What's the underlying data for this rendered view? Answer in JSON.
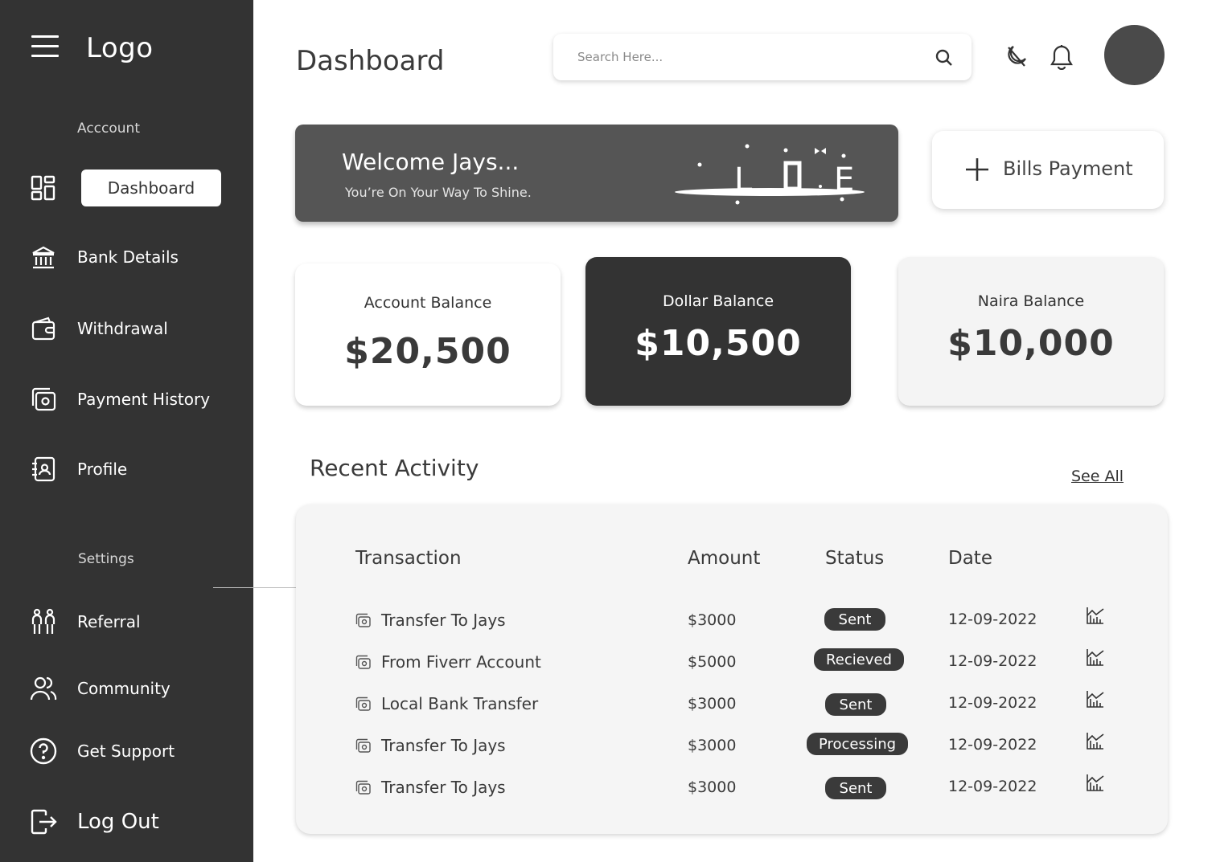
{
  "sidebar": {
    "logo": "Logo",
    "account_section": "Acccount",
    "settings_section": "Settings",
    "items": [
      {
        "label": "Dashboard",
        "icon": "dashboard-grid-icon"
      },
      {
        "label": "Bank Details",
        "icon": "bank-icon"
      },
      {
        "label": "Withdrawal",
        "icon": "wallet-icon"
      },
      {
        "label": "Payment History",
        "icon": "cash-history-icon"
      },
      {
        "label": "Profile",
        "icon": "contact-book-icon"
      },
      {
        "label": "Referral",
        "icon": "people-icon"
      },
      {
        "label": "Community",
        "icon": "community-icon"
      },
      {
        "label": "Get Support",
        "icon": "help-icon"
      },
      {
        "label": "Log Out",
        "icon": "logout-icon"
      }
    ]
  },
  "header": {
    "title": "Dashboard",
    "search_placeholder": "Search Here..."
  },
  "welcome": {
    "title": "Welcome Jays...",
    "subtitle": "You’re On Your Way To Shine."
  },
  "bills": {
    "label": "Bills Payment"
  },
  "balances": [
    {
      "label": "Account Balance",
      "value": "$20,500"
    },
    {
      "label": "Dollar Balance",
      "value": "$10,500"
    },
    {
      "label": "Naira Balance",
      "value": "$10,000"
    }
  ],
  "activity": {
    "title": "Recent Activity",
    "see_all": "See All",
    "columns": [
      "Transaction",
      "Amount",
      "Status",
      "Date"
    ],
    "rows": [
      {
        "name": "Transfer To Jays",
        "amount": "$3000",
        "status": "Sent",
        "date": "12-09-2022"
      },
      {
        "name": "From Fiverr Account",
        "amount": "$5000",
        "status": "Recieved",
        "date": "12-09-2022"
      },
      {
        "name": "Local Bank Transfer",
        "amount": "$3000",
        "status": "Sent",
        "date": "12-09-2022"
      },
      {
        "name": "Transfer To Jays",
        "amount": "$3000",
        "status": "Processing",
        "date": "12-09-2022"
      },
      {
        "name": "Transfer To Jays",
        "amount": "$3000",
        "status": "Sent",
        "date": "12-09-2022"
      }
    ]
  },
  "colors": {
    "sidebar_bg": "#333333",
    "banner_bg": "#555555",
    "dark_card": "#333333",
    "status_badge": "#3a3a3a"
  }
}
